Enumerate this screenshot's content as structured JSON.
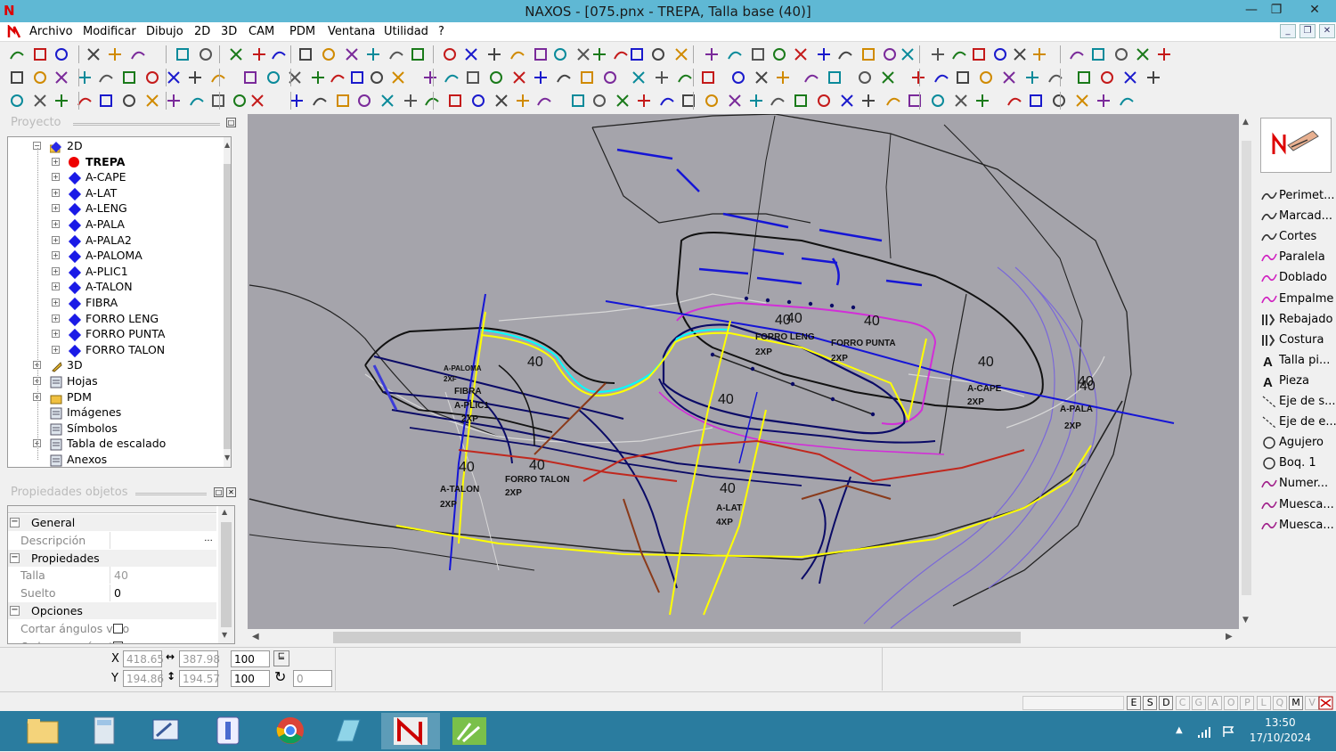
{
  "app": {
    "logo_letter": "N",
    "title": "NAXOS - [075.pnx - TREPA, Talla base (40)]",
    "window_controls": [
      "—",
      "❐",
      "✕"
    ]
  },
  "menu": {
    "items": [
      "Archivo",
      "Modificar",
      "Dibujo",
      "2D",
      "3D",
      "CAM",
      "PDM",
      "Ventana",
      "Utilidad",
      "?"
    ],
    "mdi_controls": [
      "_",
      "❐",
      "✕"
    ]
  },
  "project_panel": {
    "title": "Proyecto",
    "tree": [
      {
        "label": "2D",
        "icon": "folder-2d-icon",
        "level": 1,
        "expanded": true
      },
      {
        "label": "TREPA",
        "icon": "red-dot-icon",
        "level": 2,
        "bold": true
      },
      {
        "label": "A-CAPE",
        "icon": "blue-diamond-icon",
        "level": 2
      },
      {
        "label": "A-LAT",
        "icon": "blue-diamond-icon",
        "level": 2
      },
      {
        "label": "A-LENG",
        "icon": "blue-diamond-icon",
        "level": 2
      },
      {
        "label": "A-PALA",
        "icon": "blue-diamond-icon",
        "level": 2
      },
      {
        "label": "A-PALA2",
        "icon": "blue-diamond-icon",
        "level": 2
      },
      {
        "label": "A-PALOMA",
        "icon": "blue-diamond-icon",
        "level": 2
      },
      {
        "label": "A-PLIC1",
        "icon": "blue-diamond-icon",
        "level": 2
      },
      {
        "label": "A-TALON",
        "icon": "blue-diamond-icon",
        "level": 2
      },
      {
        "label": "FIBRA",
        "icon": "blue-diamond-icon",
        "level": 2
      },
      {
        "label": "FORRO LENG",
        "icon": "blue-diamond-icon",
        "level": 2
      },
      {
        "label": "FORRO PUNTA",
        "icon": "blue-diamond-icon",
        "level": 2
      },
      {
        "label": "FORRO TALON",
        "icon": "blue-diamond-icon",
        "level": 2
      },
      {
        "label": "3D",
        "icon": "3d-icon",
        "level": 1
      },
      {
        "label": "Hojas",
        "icon": "sheets-icon",
        "level": 1
      },
      {
        "label": "PDM",
        "icon": "pdm-icon",
        "level": 1
      },
      {
        "label": "Imágenes",
        "icon": "images-icon",
        "level": 1
      },
      {
        "label": "Símbolos",
        "icon": "symbols-icon",
        "level": 1
      },
      {
        "label": "Tabla de escalado",
        "icon": "scale-table-icon",
        "level": 1
      },
      {
        "label": "Anexos",
        "icon": "attachments-icon",
        "level": 1
      }
    ]
  },
  "properties_panel": {
    "title": "Propiedades objetos",
    "rows": [
      {
        "type": "section",
        "label": "General"
      },
      {
        "type": "field",
        "label": "Descripción",
        "value": "",
        "has_button": true,
        "button": "..."
      },
      {
        "type": "section",
        "label": "Propiedades"
      },
      {
        "type": "field",
        "label": "Talla",
        "value": "40"
      },
      {
        "type": "field",
        "label": "Suelto",
        "value": "0"
      },
      {
        "type": "section",
        "label": "Opciones"
      },
      {
        "type": "field",
        "label": "Cortar ángulos vivo",
        "checkbox": false
      },
      {
        "type": "field",
        "label": "Ordenar perímetro",
        "checkbox": false
      }
    ]
  },
  "right_tools": {
    "items": [
      {
        "label": "Perimet...",
        "icon": "perimeter-icon"
      },
      {
        "label": "Marcad...",
        "icon": "marking-icon"
      },
      {
        "label": "Cortes",
        "icon": "cuts-icon"
      },
      {
        "label": "Paralela",
        "icon": "parallel-icon"
      },
      {
        "label": "Doblado",
        "icon": "fold-icon"
      },
      {
        "label": "Empalme",
        "icon": "splice-icon"
      },
      {
        "label": "Rebajado",
        "icon": "skive-icon"
      },
      {
        "label": "Costura",
        "icon": "stitch-icon"
      },
      {
        "label": "Talla pi...",
        "icon": "size-text-icon"
      },
      {
        "label": "Pieza",
        "icon": "piece-text-icon"
      },
      {
        "label": "Eje de s...",
        "icon": "axis-icon"
      },
      {
        "label": "Eje de e...",
        "icon": "axis2-icon"
      },
      {
        "label": "Agujero",
        "icon": "hole-icon"
      },
      {
        "label": "Boq. 1",
        "icon": "punch-icon"
      },
      {
        "label": "Numer...",
        "icon": "number-icon"
      },
      {
        "label": "Muesca...",
        "icon": "notch-icon"
      },
      {
        "label": "Muesca...",
        "icon": "notch2-icon"
      }
    ]
  },
  "coords": {
    "x_label": "X",
    "y_label": "Y",
    "x": "418.65",
    "y": "194.86",
    "dx": "387.98",
    "dy": "194.57",
    "sx": "100",
    "sy": "100",
    "angle": "0"
  },
  "status_letters": [
    "E",
    "S",
    "D",
    "C",
    "G",
    "A",
    "O",
    "P",
    "L",
    "Q",
    "M",
    "V"
  ],
  "clock": {
    "time": "13:50",
    "date": "17/10/2024"
  },
  "drawing": {
    "size_labels": [
      "40",
      "40",
      "40",
      "40",
      "40",
      "40",
      "40",
      "40",
      "40",
      "40",
      "40"
    ],
    "piece_labels": [
      {
        "name": "FORRO PUNTA",
        "qty": "2XP"
      },
      {
        "name": "FORRO TALON",
        "qty": "2XP"
      },
      {
        "name": "A-TALON",
        "qty": "2XP"
      },
      {
        "name": "A-LAT",
        "qty": "4XP"
      },
      {
        "name": "FIBRA",
        "qty": "2XP"
      },
      {
        "name": "A-PLIC1",
        "qty": "2XP"
      },
      {
        "name": "A-CAPE",
        "qty": "2XP"
      },
      {
        "name": "A-PALA",
        "qty": "2XP"
      },
      {
        "name": "A-PALOMA",
        "qty": "2XF"
      },
      {
        "name": "FORRO LENG",
        "qty": "2XP"
      }
    ],
    "colors": {
      "background": "#a5a4ab",
      "blue": "#1515d6",
      "navy": "#0a0a66",
      "yellow": "#ffff00",
      "magenta": "#d22ed8",
      "brown": "#8a3a1a",
      "red": "#c0281e",
      "purple": "#7a68d8",
      "cyan": "#00ffff",
      "white_gray": "#d8d8d8"
    }
  }
}
